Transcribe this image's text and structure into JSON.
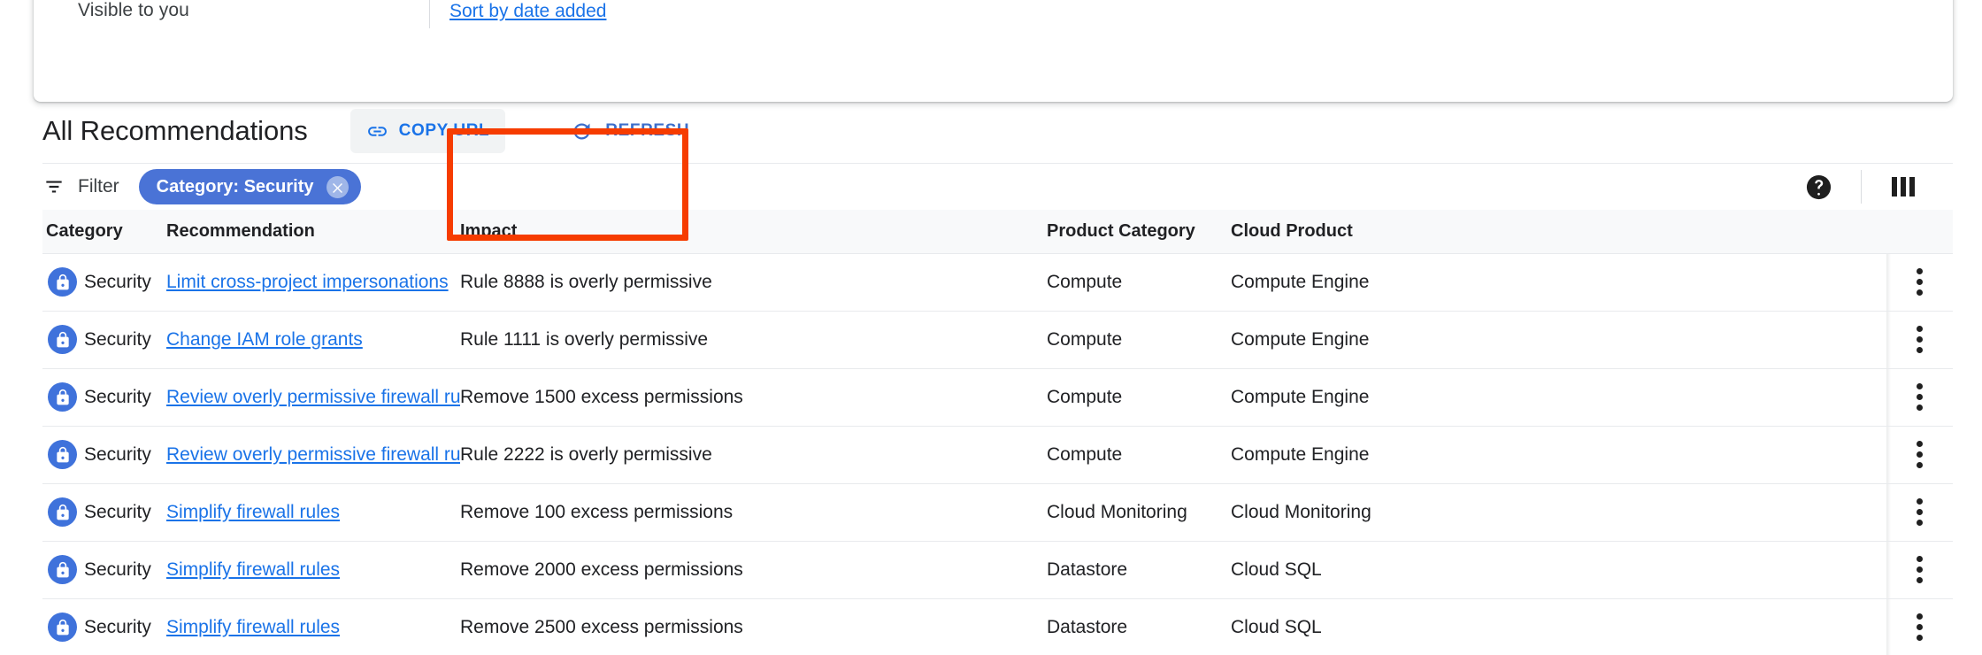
{
  "top_card": {
    "visibility_label": "Visible to you",
    "sort_link": "Sort by date added"
  },
  "section": {
    "title": "All Recommendations",
    "copy_url_label": "COPY URL",
    "refresh_label": "REFRESH",
    "copy_url_icon": "link-icon",
    "refresh_icon": "refresh-icon"
  },
  "annotation": {
    "color": "#f63c00",
    "target": "copy-url-button"
  },
  "filter_bar": {
    "filter_label": "Filter",
    "filter_icon": "filter-icon",
    "chip_label": "Category: Security",
    "chip_remove_icon": "close-circle-icon",
    "help_icon": "help-icon",
    "columns_icon": "columns-icon"
  },
  "table": {
    "columns": [
      "Category",
      "Recommendation",
      "Impact",
      "Product Category",
      "Cloud Product"
    ],
    "row_icon": "lock-icon",
    "row_action_icon": "more-vert-icon",
    "rows": [
      {
        "category": "Security",
        "recommendation": "Limit cross-project impersonations",
        "impact": "Rule 8888 is overly permissive",
        "product_category": "Compute",
        "cloud_product": "Compute Engine"
      },
      {
        "category": "Security",
        "recommendation": "Change IAM role grants",
        "impact": "Rule 1111 is overly permissive",
        "product_category": "Compute",
        "cloud_product": "Compute Engine"
      },
      {
        "category": "Security",
        "recommendation": "Review overly permissive firewall rules",
        "impact": "Remove 1500 excess permissions",
        "product_category": "Compute",
        "cloud_product": "Compute Engine"
      },
      {
        "category": "Security",
        "recommendation": "Review overly permissive firewall rules",
        "impact": "Rule 2222 is overly permissive",
        "product_category": "Compute",
        "cloud_product": "Compute Engine"
      },
      {
        "category": "Security",
        "recommendation": "Simplify firewall rules",
        "impact": "Remove 100 excess permissions",
        "product_category": "Cloud Monitoring",
        "cloud_product": "Cloud Monitoring"
      },
      {
        "category": "Security",
        "recommendation": "Simplify firewall rules",
        "impact": "Remove 2000 excess permissions",
        "product_category": "Datastore",
        "cloud_product": "Cloud SQL"
      },
      {
        "category": "Security",
        "recommendation": "Simplify firewall rules",
        "impact": "Remove 2500 excess permissions",
        "product_category": "Datastore",
        "cloud_product": "Cloud SQL"
      }
    ]
  },
  "colors": {
    "link": "#1a73e8",
    "chip": "#4a73d6",
    "lock_badge": "#3f72db",
    "header_bg": "#f8f9fa",
    "annotation": "#f63c00"
  }
}
